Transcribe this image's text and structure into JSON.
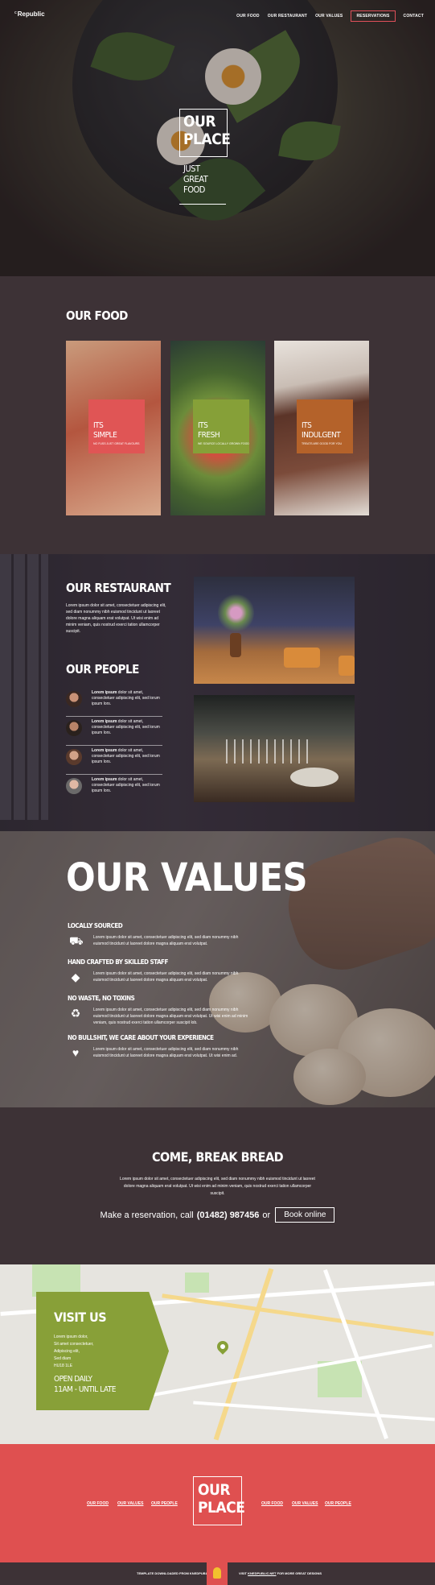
{
  "nav": {
    "logo_prefix": "c",
    "logo": "Republic",
    "links": [
      "OUR FOOD",
      "OUR RESTAURANT",
      "OUR VALUES",
      "RESERVATIONS",
      "CONTACT"
    ]
  },
  "hero": {
    "title_1": "OUR",
    "title_2": "PLACE",
    "sub_1": "JUST",
    "sub_2": "GREAT",
    "sub_3": "FOOD"
  },
  "food": {
    "title": "OUR FOOD",
    "cards": [
      {
        "t1": "ITS",
        "t2": "SIMPLE",
        "sub": "NO FUSS JUST GREAT FLAVOURS",
        "color": "#e05555"
      },
      {
        "t1": "ITS",
        "t2": "FRESH",
        "sub": "WE SOURCE LOCALLY GROWN FOOD",
        "color": "#86a038"
      },
      {
        "t1": "ITS",
        "t2": "INDULGENT",
        "sub": "TREATS ARE GOOD FOR YOU",
        "color": "#b4622a"
      }
    ]
  },
  "restaurant": {
    "title": "OUR RESTAURANT",
    "text": "Lorem ipsum dolor sit amet, consectetuer adipiscing elit, sed diam nonummy nibh euismod tincidunt ut laoreet dolore magna aliquam erat volutpat. Ut wisi enim ad minim veniam, quis nostrud exerci tation ullamcorper suscipit.",
    "people_title": "OUR PEOPLE",
    "people": [
      {
        "bold": "Lorem ipsum",
        "text": " dolor sit amet, consectetuer adipiscing elit, sed lorum ipsum lors."
      },
      {
        "bold": "Lorem ipsum",
        "text": " dolor sit amet, consectetuer adipiscing elit, sed lorum ipsum lors."
      },
      {
        "bold": "Lorem ipsum",
        "text": " dolor sit amet, consectetuer adipiscing elit, sed lorum ipsum lors."
      },
      {
        "bold": "Lorem ipsum",
        "text": " dolor sit amet, consectetuer adipiscing elit, sed lorum ipsum lors."
      }
    ]
  },
  "values": {
    "title": "OUR VALUES",
    "items": [
      {
        "head": "LOCALLY SOURCED",
        "icon": "truck-icon",
        "glyph": "⛟",
        "text": "Lorem ipsum dolor sit amet, consectetuer adipiscing elit, sed diam nonummy nibh euismod tincidunt ut laoreet dolore magna aliquam erat volutpat."
      },
      {
        "head": "HAND CRAFTED BY SKILLED STAFF",
        "icon": "diamond-icon",
        "glyph": "◆",
        "text": "Lorem ipsum dolor sit amet, consectetuer adipiscing elit, sed diam nonummy nibh euismod tincidunt ut laoreet dolore magna aliquam erat volutpat."
      },
      {
        "head": "NO WASTE, NO TOXINS",
        "icon": "recycle-icon",
        "glyph": "♻",
        "text": "Lorem ipsum dolor sit amet, consectetuer adipiscing elit, sed diam nonummy nibh euismod tincidunt ut laoreet dolore magna aliquam erat volutpat. Ut wisi enim ad minim veniam, quis nostrud exerci tation ullamcorper suscipit lob."
      },
      {
        "head": "NO BULLSHIT, WE CARE ABOUT YOUR EXPERIENCE",
        "icon": "heart-hand-icon",
        "glyph": "♥",
        "text": "Lorem ipsum dolor sit amet, consectetuer adipiscing elit, sed diam nonummy nibh euismod tincidunt ut laoreet dolore magna aliquam erat volutpat. Ut wisi enim ad."
      }
    ]
  },
  "bread": {
    "title": "COME, BREAK BREAD",
    "text": "Lorem ipsum dolor sit amet, consectetuer adipiscing elit, sed diam nonummy nibh euismod tincidunt ut laoreet dolore magna aliquam erat volutpat. Ut wisi enim ad minim veniam, quis nostrud exerci tation ullamcorper suscipit.",
    "cta_prefix": "Make a reservation, call",
    "phone": "(01482) 987456",
    "cta_or": "or",
    "book": "Book online"
  },
  "map": {
    "title": "VISIT US",
    "address": [
      "Lorem ipsum dolor,",
      "Sit amet consectetuer,",
      "Adipiscing elit,",
      "Sed diam",
      "HU18 1LE"
    ],
    "hours_1": "OPEN DAILY",
    "hours_2": "11AM - UNTIL LATE"
  },
  "footer": {
    "left_links": [
      "OUR FOOD",
      "OUR VALUES",
      "OUR PEOPLE"
    ],
    "right_links": [
      "OUR FOOD",
      "OUR VALUES",
      "OUR PEOPLE"
    ],
    "title_1": "OUR",
    "title_2": "PLACE"
  },
  "credits": {
    "left": "TEMPLATE DOWNLOADED FROM KNEDPUBLIC",
    "right_prefix": "VISIT",
    "right_link": "KNEDPUBLIC.NET",
    "right_suffix": "FOR MORE GREAT DESIGNS"
  }
}
